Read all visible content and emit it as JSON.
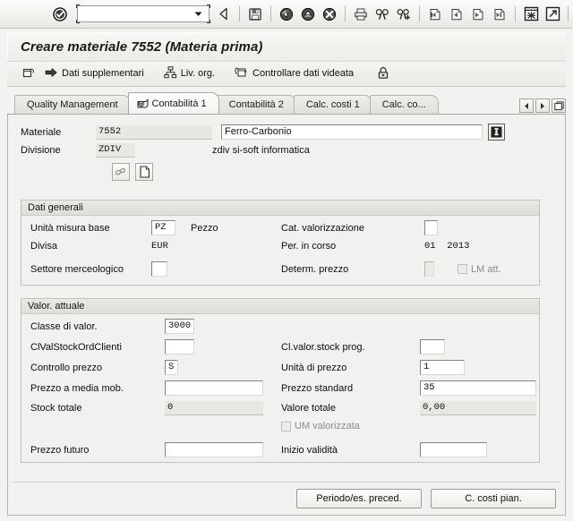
{
  "command_bar": {
    "ok_icon": "check-circle-icon",
    "command_field": {
      "value": "",
      "placeholder": ""
    },
    "icons": [
      "back-icon",
      "save-icon",
      "back-green-icon",
      "exit-up-icon",
      "cancel-icon",
      "print-icon",
      "find-icon",
      "find-next-icon",
      "first-page-icon",
      "previous-page-icon",
      "next-page-icon",
      "last-page-icon",
      "new-session-icon",
      "create-shortcut-icon",
      "help-icon",
      "customize-layout-icon"
    ]
  },
  "title": "Creare materiale 7552 (Materia prima)",
  "app_toolbar": {
    "buttons": [
      {
        "name": "additional-data",
        "icon": "screen-icon",
        "label": ""
      },
      {
        "name": "dati-supplementari",
        "icon": "arrow-right-icon",
        "label": "Dati supplementari"
      },
      {
        "name": "liv-org",
        "icon": "org-levels-icon",
        "label": "Liv. org."
      },
      {
        "name": "controllare-dati-videata",
        "icon": "check-screen-icon",
        "label": "Controllare dati videata"
      },
      {
        "name": "lock",
        "icon": "lock-icon",
        "label": ""
      }
    ]
  },
  "tabs": {
    "items": [
      {
        "label": "Quality Management",
        "active": false,
        "icon": null
      },
      {
        "label": "Contabilità 1",
        "active": true,
        "icon": "selected-tab-icon"
      },
      {
        "label": "Contabilità 2",
        "active": false,
        "icon": null
      },
      {
        "label": "Calc. costi 1",
        "active": false,
        "icon": null
      },
      {
        "label": "Calc. co...",
        "active": false,
        "icon": null
      }
    ],
    "nav": [
      "scroll-left-icon",
      "scroll-right-icon",
      "tab-list-icon"
    ]
  },
  "header": {
    "materiale_label": "Materiale",
    "materiale_value": "7552",
    "materiale_desc": "Ferro-Carbonio",
    "info_icon": "info-button-icon",
    "divisione_label": "Divisione",
    "divisione_value": "ZDIV",
    "divisione_desc": "zdiv si-soft informatica",
    "icon_buttons": [
      {
        "name": "link-chain-icon"
      },
      {
        "name": "document-page-icon"
      }
    ]
  },
  "dati_generali": {
    "title": "Dati generali",
    "fields": {
      "unita_misura_base_label": "Unità misura base",
      "unita_misura_base_value": "PZ",
      "unita_misura_base_text": "Pezzo",
      "cat_valorizzazione_label": "Cat. valorizzazione",
      "cat_valorizzazione_value": "",
      "divisa_label": "Divisa",
      "divisa_value": "EUR",
      "per_in_corso_label": "Per. in corso",
      "per_in_corso_value": "01  2013",
      "settore_merceologico_label": "Settore merceologico",
      "settore_merceologico_value": "",
      "determ_prezzo_label": "Determ. prezzo",
      "determ_prezzo_value": "",
      "lm_att_label": "LM att.",
      "lm_att_checked": false
    }
  },
  "valor_attuale": {
    "title": "Valor. attuale",
    "fields": {
      "classe_di_valor_label": "Classe di valor.",
      "classe_di_valor_value": "3000",
      "clvalstockordclienti_label": "ClValStockOrdClienti",
      "clvalstockordclienti_value": "",
      "cl_valor_stock_prog_label": "Cl.valor.stock prog.",
      "cl_valor_stock_prog_value": "",
      "controllo_prezzo_label": "Controllo prezzo",
      "controllo_prezzo_value": "S",
      "unita_di_prezzo_label": "Unità di prezzo",
      "unita_di_prezzo_value": "1",
      "prezzo_a_media_mob_label": "Prezzo a media mob.",
      "prezzo_a_media_mob_value": "",
      "prezzo_standard_label": "Prezzo standard",
      "prezzo_standard_value": "35",
      "stock_totale_label": "Stock totale",
      "stock_totale_value": "0",
      "valore_totale_label": "Valore totale",
      "valore_totale_value": "0,00",
      "um_valorizzata_label": "UM valorizzata",
      "um_valorizzata_checked": false,
      "prezzo_futuro_label": "Prezzo futuro",
      "prezzo_futuro_value": "",
      "inizio_validita_label": "Inizio validità",
      "inizio_validita_value": ""
    }
  },
  "footer_buttons": [
    {
      "name": "periodo-es-preced-button",
      "label": "Periodo/es. preced."
    },
    {
      "name": "c-costi-pian-button",
      "label": "C. costi pian."
    }
  ],
  "colors": {
    "window_bg": "#f1f1ef",
    "toolbar_bg": "#f1f1ef",
    "field_bg": "#ffffff",
    "readonly_bg": "#e7e7e4",
    "border": "#b6b6b0"
  }
}
